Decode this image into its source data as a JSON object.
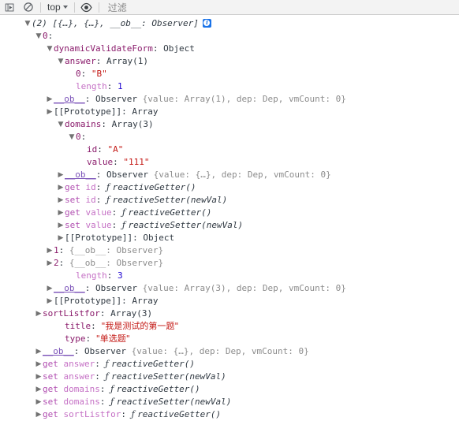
{
  "toolbar": {
    "step_icon": "step-into-icon",
    "clear_icon": "clear-console-icon",
    "context_label": "top",
    "eye_icon": "eye-icon",
    "filter_placeholder": "过滤"
  },
  "console": {
    "badge_label": "i",
    "rows": [
      {
        "indent": "ihdr",
        "arrow": "▼",
        "tokens": [
          {
            "c": "arraysum",
            "t": "(2) [{…}, {…}, __ob__: Observer]"
          }
        ],
        "badge": true,
        "name": "console-root-array"
      },
      {
        "indent": "i0",
        "arrow": "▼",
        "tokens": [
          {
            "c": "prop",
            "t": "0"
          },
          {
            "c": "plain",
            "t": ":"
          }
        ],
        "name": "tree-node-index-0"
      },
      {
        "indent": "i1",
        "arrow": "▼",
        "tokens": [
          {
            "c": "prop",
            "t": "dynamicValidateForm"
          },
          {
            "c": "plain",
            "t": ": "
          },
          {
            "c": "objname",
            "t": "Object"
          }
        ],
        "name": "tree-node-dynamic-validate-form"
      },
      {
        "indent": "i2",
        "arrow": "▼",
        "tokens": [
          {
            "c": "prop",
            "t": "answer"
          },
          {
            "c": "plain",
            "t": ": "
          },
          {
            "c": "objname",
            "t": "Array(1)"
          }
        ],
        "name": "tree-node-answer"
      },
      {
        "indent": "i3",
        "arrow": "",
        "tokens": [
          {
            "c": "prop",
            "t": "0"
          },
          {
            "c": "plain",
            "t": ": "
          },
          {
            "c": "str",
            "t": "\"B\""
          }
        ],
        "name": "tree-leaf-answer-0"
      },
      {
        "indent": "i3",
        "arrow": "",
        "tokens": [
          {
            "c": "prop-dim",
            "t": "length"
          },
          {
            "c": "plain",
            "t": ": "
          },
          {
            "c": "num",
            "t": "1"
          }
        ],
        "name": "tree-leaf-answer-length"
      },
      {
        "indent": "i2x",
        "arrow": "▶",
        "tokens": [
          {
            "c": "prop-ob",
            "t": "__ob__"
          },
          {
            "c": "plain",
            "t": ": "
          },
          {
            "c": "objname",
            "t": "Observer "
          },
          {
            "c": "preview",
            "t": "{value: Array(1), dep: Dep, vmCount: 0}"
          }
        ],
        "name": "tree-node-answer-ob"
      },
      {
        "indent": "i2x",
        "arrow": "▶",
        "tokens": [
          {
            "c": "proto",
            "t": "[[Prototype]]"
          },
          {
            "c": "plain",
            "t": ": "
          },
          {
            "c": "objname",
            "t": "Array"
          }
        ],
        "name": "tree-node-answer-prototype"
      },
      {
        "indent": "i2",
        "arrow": "▼",
        "tokens": [
          {
            "c": "prop",
            "t": "domains"
          },
          {
            "c": "plain",
            "t": ": "
          },
          {
            "c": "objname",
            "t": "Array(3)"
          }
        ],
        "name": "tree-node-domains"
      },
      {
        "indent": "i3",
        "arrow": "▼",
        "tokens": [
          {
            "c": "prop",
            "t": "0"
          },
          {
            "c": "plain",
            "t": ":"
          }
        ],
        "name": "tree-node-domains-0"
      },
      {
        "indent": "i4",
        "arrow": "",
        "tokens": [
          {
            "c": "prop",
            "t": "id"
          },
          {
            "c": "plain",
            "t": ": "
          },
          {
            "c": "str",
            "t": "\"A\""
          }
        ],
        "name": "tree-leaf-domain-id"
      },
      {
        "indent": "i4",
        "arrow": "",
        "tokens": [
          {
            "c": "prop",
            "t": "value"
          },
          {
            "c": "plain",
            "t": ": "
          },
          {
            "c": "str",
            "t": "\"111\""
          }
        ],
        "name": "tree-leaf-domain-value"
      },
      {
        "indent": "i3x",
        "arrow": "▶",
        "tokens": [
          {
            "c": "prop-ob",
            "t": "__ob__"
          },
          {
            "c": "plain",
            "t": ": "
          },
          {
            "c": "objname",
            "t": "Observer "
          },
          {
            "c": "preview",
            "t": "{value: {…}, dep: Dep, vmCount: 0}"
          }
        ],
        "name": "tree-node-domain-ob"
      },
      {
        "indent": "i3x",
        "arrow": "▶",
        "tokens": [
          {
            "c": "kw",
            "t": "get "
          },
          {
            "c": "accessor",
            "t": "id"
          },
          {
            "c": "plain",
            "t": ": "
          },
          {
            "c": "fnsym",
            "t": "ƒ "
          },
          {
            "c": "fn",
            "t": "reactiveGetter()"
          }
        ],
        "name": "tree-node-get-id"
      },
      {
        "indent": "i3x",
        "arrow": "▶",
        "tokens": [
          {
            "c": "kw",
            "t": "set "
          },
          {
            "c": "accessor",
            "t": "id"
          },
          {
            "c": "plain",
            "t": ": "
          },
          {
            "c": "fnsym",
            "t": "ƒ "
          },
          {
            "c": "fn",
            "t": "reactiveSetter(newVal)"
          }
        ],
        "name": "tree-node-set-id"
      },
      {
        "indent": "i3x",
        "arrow": "▶",
        "tokens": [
          {
            "c": "kw",
            "t": "get "
          },
          {
            "c": "accessor",
            "t": "value"
          },
          {
            "c": "plain",
            "t": ": "
          },
          {
            "c": "fnsym",
            "t": "ƒ "
          },
          {
            "c": "fn",
            "t": "reactiveGetter()"
          }
        ],
        "name": "tree-node-get-value"
      },
      {
        "indent": "i3x",
        "arrow": "▶",
        "tokens": [
          {
            "c": "kw",
            "t": "set "
          },
          {
            "c": "accessor",
            "t": "value"
          },
          {
            "c": "plain",
            "t": ": "
          },
          {
            "c": "fnsym",
            "t": "ƒ "
          },
          {
            "c": "fn",
            "t": "reactiveSetter(newVal)"
          }
        ],
        "name": "tree-node-set-value"
      },
      {
        "indent": "i3x",
        "arrow": "▶",
        "tokens": [
          {
            "c": "proto",
            "t": "[[Prototype]]"
          },
          {
            "c": "plain",
            "t": ": "
          },
          {
            "c": "objname",
            "t": "Object"
          }
        ],
        "name": "tree-node-domain-prototype"
      },
      {
        "indent": "i2x",
        "arrow": "▶",
        "tokens": [
          {
            "c": "prop",
            "t": "1"
          },
          {
            "c": "plain",
            "t": ": "
          },
          {
            "c": "preview",
            "t": "{__ob__: Observer}"
          }
        ],
        "name": "tree-node-domains-1"
      },
      {
        "indent": "i2x",
        "arrow": "▶",
        "tokens": [
          {
            "c": "prop",
            "t": "2"
          },
          {
            "c": "plain",
            "t": ": "
          },
          {
            "c": "preview",
            "t": "{__ob__: Observer}"
          }
        ],
        "name": "tree-node-domains-2"
      },
      {
        "indent": "i3",
        "arrow": "",
        "tokens": [
          {
            "c": "prop-dim",
            "t": "length"
          },
          {
            "c": "plain",
            "t": ": "
          },
          {
            "c": "num",
            "t": "3"
          }
        ],
        "name": "tree-leaf-domains-length"
      },
      {
        "indent": "i2x",
        "arrow": "▶",
        "tokens": [
          {
            "c": "prop-ob",
            "t": "__ob__"
          },
          {
            "c": "plain",
            "t": ": "
          },
          {
            "c": "objname",
            "t": "Observer "
          },
          {
            "c": "preview",
            "t": "{value: Array(3), dep: Dep, vmCount: 0}"
          }
        ],
        "name": "tree-node-domains-ob"
      },
      {
        "indent": "i2x",
        "arrow": "▶",
        "tokens": [
          {
            "c": "proto",
            "t": "[[Prototype]]"
          },
          {
            "c": "plain",
            "t": ": "
          },
          {
            "c": "objname",
            "t": "Array"
          }
        ],
        "name": "tree-node-domains-prototype"
      },
      {
        "indent": "i1x",
        "arrow": "▶",
        "tokens": [
          {
            "c": "prop",
            "t": "sortListfor"
          },
          {
            "c": "plain",
            "t": ": "
          },
          {
            "c": "objname",
            "t": "Array(3)"
          }
        ],
        "name": "tree-node-sort-listfor"
      },
      {
        "indent": "i2",
        "arrow": "",
        "tokens": [
          {
            "c": "prop",
            "t": "title"
          },
          {
            "c": "plain",
            "t": ": "
          },
          {
            "c": "str cjk",
            "t": "\"我是测试的第一题\""
          }
        ],
        "name": "tree-leaf-title"
      },
      {
        "indent": "i2",
        "arrow": "",
        "tokens": [
          {
            "c": "prop",
            "t": "type"
          },
          {
            "c": "plain",
            "t": ": "
          },
          {
            "c": "str cjk",
            "t": "\"单选题\""
          }
        ],
        "name": "tree-leaf-type"
      },
      {
        "indent": "i1x",
        "arrow": "▶",
        "tokens": [
          {
            "c": "prop-ob",
            "t": "__ob__"
          },
          {
            "c": "plain",
            "t": ": "
          },
          {
            "c": "objname",
            "t": "Observer "
          },
          {
            "c": "preview",
            "t": "{value: {…}, dep: Dep, vmCount: 0}"
          }
        ],
        "name": "tree-node-form-ob"
      },
      {
        "indent": "i1x",
        "arrow": "▶",
        "tokens": [
          {
            "c": "kw",
            "t": "get "
          },
          {
            "c": "accessor",
            "t": "answer"
          },
          {
            "c": "plain",
            "t": ": "
          },
          {
            "c": "fnsym",
            "t": "ƒ "
          },
          {
            "c": "fn",
            "t": "reactiveGetter()"
          }
        ],
        "name": "tree-node-get-answer"
      },
      {
        "indent": "i1x",
        "arrow": "▶",
        "tokens": [
          {
            "c": "kw",
            "t": "set "
          },
          {
            "c": "accessor",
            "t": "answer"
          },
          {
            "c": "plain",
            "t": ": "
          },
          {
            "c": "fnsym",
            "t": "ƒ "
          },
          {
            "c": "fn",
            "t": "reactiveSetter(newVal)"
          }
        ],
        "name": "tree-node-set-answer"
      },
      {
        "indent": "i1x",
        "arrow": "▶",
        "tokens": [
          {
            "c": "kw",
            "t": "get "
          },
          {
            "c": "accessor",
            "t": "domains"
          },
          {
            "c": "plain",
            "t": ": "
          },
          {
            "c": "fnsym",
            "t": "ƒ "
          },
          {
            "c": "fn",
            "t": "reactiveGetter()"
          }
        ],
        "name": "tree-node-get-domains"
      },
      {
        "indent": "i1x",
        "arrow": "▶",
        "tokens": [
          {
            "c": "kw",
            "t": "set "
          },
          {
            "c": "accessor",
            "t": "domains"
          },
          {
            "c": "plain",
            "t": ": "
          },
          {
            "c": "fnsym",
            "t": "ƒ "
          },
          {
            "c": "fn",
            "t": "reactiveSetter(newVal)"
          }
        ],
        "name": "tree-node-set-domains"
      },
      {
        "indent": "i1x",
        "arrow": "▶",
        "tokens": [
          {
            "c": "kw",
            "t": "get "
          },
          {
            "c": "accessor",
            "t": "sortListfor"
          },
          {
            "c": "plain",
            "t": ": "
          },
          {
            "c": "fnsym",
            "t": "ƒ "
          },
          {
            "c": "fn",
            "t": "reactiveGetter()"
          }
        ],
        "name": "tree-node-get-sort-listfor"
      }
    ]
  }
}
